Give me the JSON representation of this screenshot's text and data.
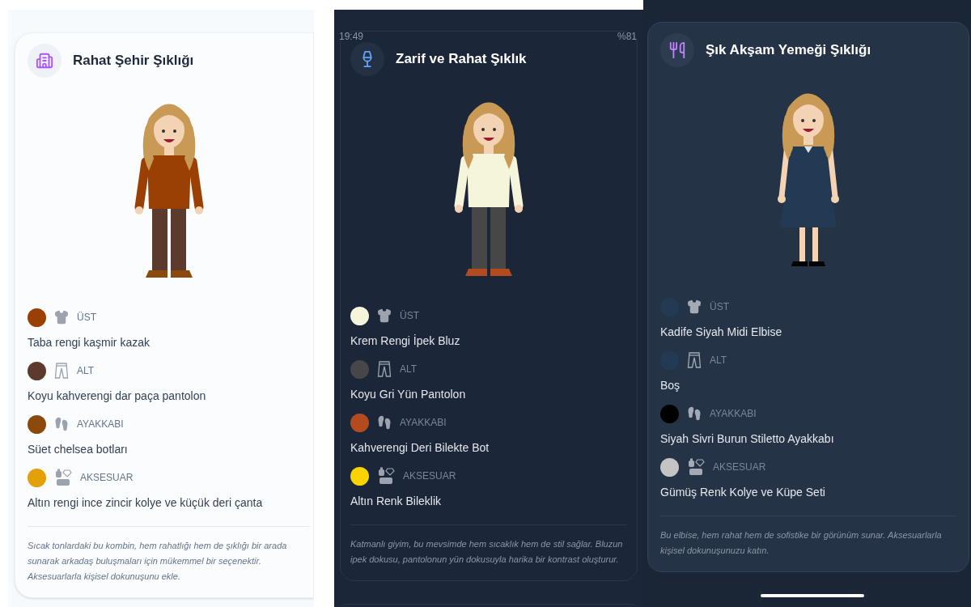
{
  "panels": [
    {
      "card": {
        "title": "Rahat Şehir Şıklığı",
        "items": [
          {
            "kind": "top",
            "category": "ÜST",
            "color": "#9a4005",
            "name": "Taba rengi kaşmir kazak"
          },
          {
            "kind": "bottom",
            "category": "ALT",
            "color": "#5d3a2e",
            "name": "Koyu kahverengi dar paça pantolon"
          },
          {
            "kind": "shoes",
            "category": "AYAKKABI",
            "color": "#8b4a0c",
            "name": "Süet chelsea botları"
          },
          {
            "kind": "accessory",
            "category": "AKSESUAR",
            "color": "#e3a008",
            "name": "Altın rengi ince zincir kolye ve küçük deri çanta"
          }
        ],
        "note": "Sıcak tonlardaki bu kombin, hem rahatlığı hem de şıklığı bir arada sunarak arkadaş buluşmaları için mükemmel bir seçenektir. Aksesuarlarla kişisel dokunuşunu ekle."
      }
    },
    {
      "status_bar": {
        "time": "19:49",
        "battery": "%81"
      },
      "more_card_below": true,
      "card": {
        "title": "Zarif ve Rahat Şıklık",
        "items": [
          {
            "kind": "top",
            "category": "ÜST",
            "color": "#f5f5dc",
            "name": "Krem Rengi İpek Bluz"
          },
          {
            "kind": "bottom",
            "category": "ALT",
            "color": "#474747",
            "name": "Koyu Gri Yün Pantolon"
          },
          {
            "kind": "shoes",
            "category": "AYAKKABI",
            "color": "#b34b1f",
            "name": "Kahverengi Deri Bilekte Bot"
          },
          {
            "kind": "accessory",
            "category": "AKSESUAR",
            "color": "#fbd400",
            "name": "Altın Renk Bileklik"
          }
        ],
        "note": "Katmanlı giyim, bu mevsimde hem sıcaklık hem de stil sağlar. Bluzun ipek dokusu, pantolonun yün dokusuyla harika bir kontrast oluşturur."
      }
    },
    {
      "home_indicator": true,
      "card": {
        "title": "Şık Akşam Yemeği Şıklığı",
        "items": [
          {
            "kind": "top",
            "category": "ÜST",
            "color": "#233a54",
            "name": "Kadife Siyah Midi Elbise"
          },
          {
            "kind": "bottom",
            "category": "ALT",
            "color": "#233a54",
            "name": "Boş"
          },
          {
            "kind": "shoes",
            "category": "AYAKKABI",
            "color": "#000000",
            "name": "Siyah Sivri Burun Stiletto Ayakkabı"
          },
          {
            "kind": "accessory",
            "category": "AKSESUAR",
            "color": "#c4c4c4",
            "name": "Gümüş Renk Kolye ve Küpe Seti"
          }
        ],
        "note": "Bu elbise, hem rahat hem de sofistike bir görünüm sunar. Aksesuarlarla kişisel dokunuşunuzu katın."
      }
    }
  ]
}
